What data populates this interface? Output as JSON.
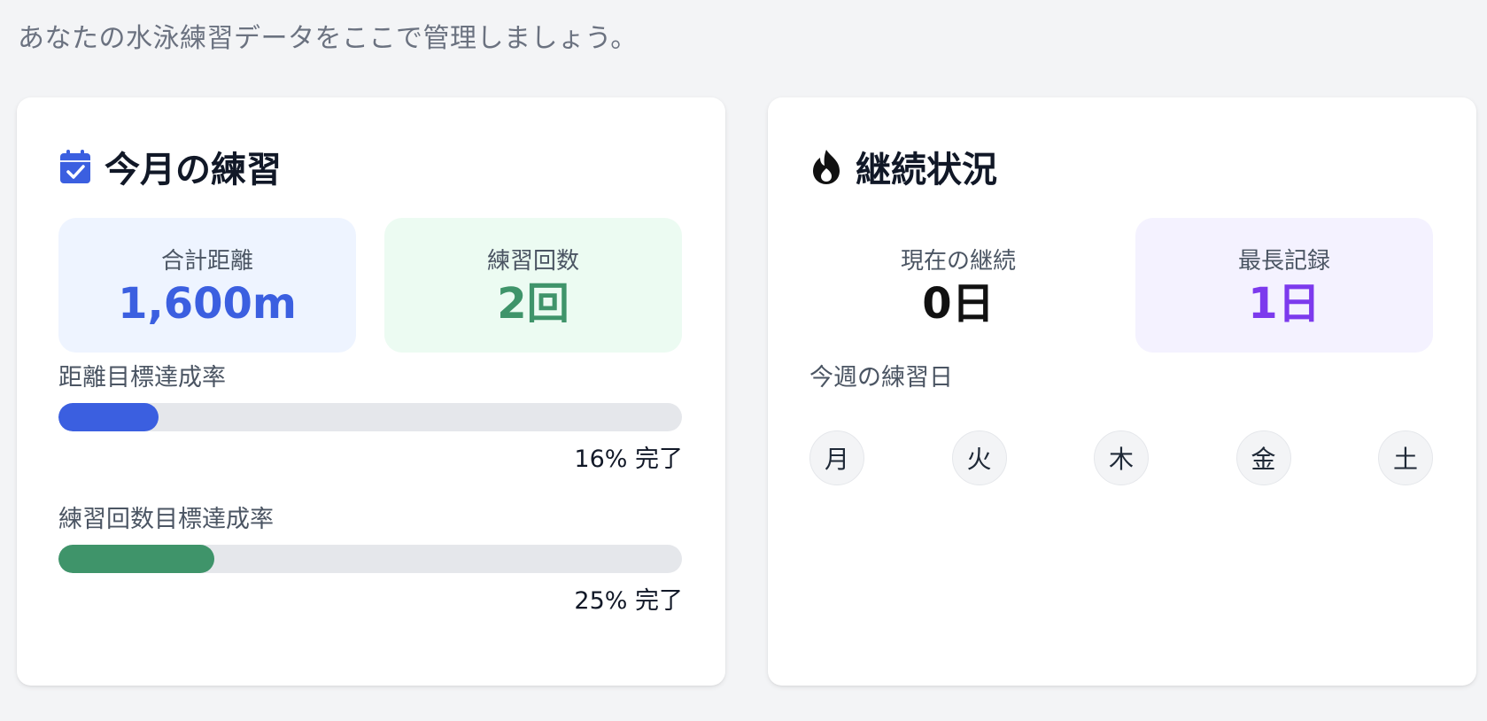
{
  "intro_text": "あなたの水泳練習データをここで管理しましょう。",
  "monthly": {
    "title": "今月の練習",
    "icon": "calendar-check-icon",
    "total_distance": {
      "label": "合計距離",
      "value": "1,600m",
      "color": "#3b5fe0",
      "bg": "#eef4ff"
    },
    "practice_count": {
      "label": "練習回数",
      "value": "2回",
      "color": "#3f946a",
      "bg": "#ecfbf2"
    },
    "distance_goal": {
      "label": "距離目標達成率",
      "percent": 16,
      "caption": "16% 完了",
      "color": "#3b5fe0"
    },
    "count_goal": {
      "label": "練習回数目標達成率",
      "percent": 25,
      "caption": "25% 完了",
      "color": "#3f946a"
    }
  },
  "streak": {
    "title": "継続状況",
    "icon": "flame-icon",
    "current": {
      "label": "現在の継続",
      "value": "0日",
      "color": "#111111",
      "bg": "#ffffff"
    },
    "longest": {
      "label": "最長記録",
      "value": "1日",
      "color": "#7c3aed",
      "bg": "#f4f2ff"
    },
    "week_label": "今週の練習日",
    "week_days": [
      "月",
      "火",
      "木",
      "金",
      "土"
    ]
  }
}
